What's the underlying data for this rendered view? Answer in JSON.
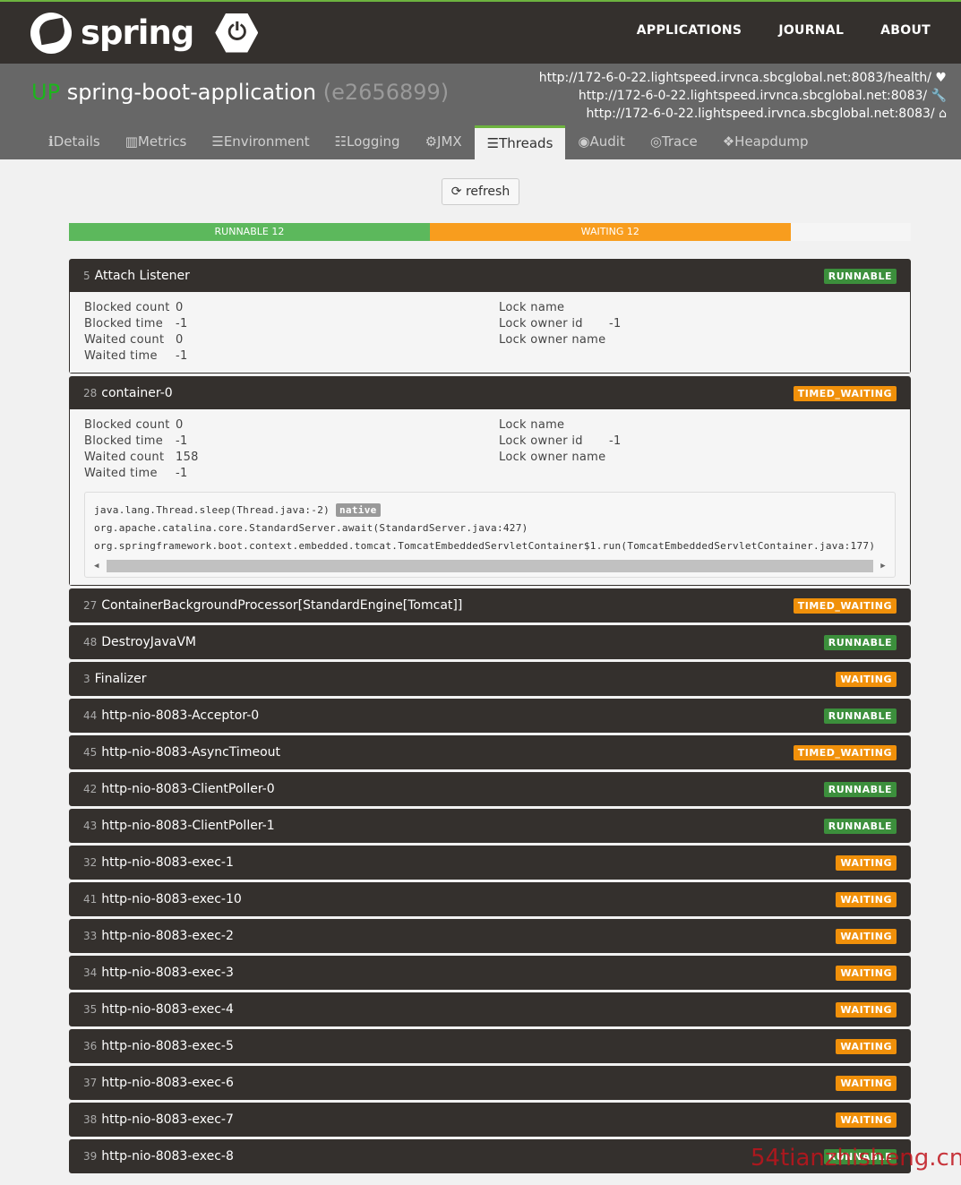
{
  "header": {
    "brand": "spring",
    "nav": [
      "APPLICATIONS",
      "JOURNAL",
      "ABOUT"
    ]
  },
  "app": {
    "status": "UP",
    "name": "spring-boot-application",
    "version": "(e2656899)",
    "urls": [
      {
        "text": "http://172-6-0-22.lightspeed.irvnca.sbcglobal.net:8083/health/",
        "icon": "heartbeat-icon",
        "glyph": "♥"
      },
      {
        "text": "http://172-6-0-22.lightspeed.irvnca.sbcglobal.net:8083/",
        "icon": "wrench-icon",
        "glyph": "🔧"
      },
      {
        "text": "http://172-6-0-22.lightspeed.irvnca.sbcglobal.net:8083/",
        "icon": "home-icon",
        "glyph": "⌂"
      }
    ]
  },
  "tabs": [
    {
      "label": "Details",
      "icon": "ℹ"
    },
    {
      "label": "Metrics",
      "icon": "▥"
    },
    {
      "label": "Environment",
      "icon": "☰"
    },
    {
      "label": "Logging",
      "icon": "☷"
    },
    {
      "label": "JMX",
      "icon": "⚙"
    },
    {
      "label": "Threads",
      "icon": "☰",
      "active": true
    },
    {
      "label": "Audit",
      "icon": "◉"
    },
    {
      "label": "Trace",
      "icon": "◎"
    },
    {
      "label": "Heapdump",
      "icon": "❖"
    }
  ],
  "refresh_label": "refresh",
  "summary": [
    {
      "label": "RUNNABLE 12",
      "fraction": 0.4286,
      "color": "#5cb85c"
    },
    {
      "label": "WAITING 12",
      "fraction": 0.4286,
      "color": "#f89d1e"
    }
  ],
  "colors": {
    "RUNNABLE": "#3c8f3c",
    "WAITING": "#f0900a",
    "TIMED_WAITING": "#f0900a"
  },
  "details_labels": {
    "blocked_count": "Blocked count",
    "blocked_time": "Blocked time",
    "waited_count": "Waited count",
    "waited_time": "Waited time",
    "lock_name": "Lock name",
    "lock_owner_id": "Lock owner id",
    "lock_owner_name": "Lock owner name"
  },
  "threads": [
    {
      "id": "5",
      "name": "Attach Listener",
      "state": "RUNNABLE",
      "expanded": true,
      "blocked_count": "0",
      "blocked_time": "-1",
      "waited_count": "0",
      "waited_time": "-1",
      "lock_name": "",
      "lock_owner_id": "-1",
      "lock_owner_name": ""
    },
    {
      "id": "28",
      "name": "container-0",
      "state": "TIMED_WAITING",
      "expanded": true,
      "blocked_count": "0",
      "blocked_time": "-1",
      "waited_count": "158",
      "waited_time": "-1",
      "lock_name": "",
      "lock_owner_id": "-1",
      "lock_owner_name": "",
      "stack": [
        {
          "text": "java.lang.Thread.sleep(Thread.java:-2)",
          "native": "native"
        },
        {
          "text": "org.apache.catalina.core.StandardServer.await(StandardServer.java:427)"
        },
        {
          "text": "org.springframework.boot.context.embedded.tomcat.TomcatEmbeddedServletContainer$1.run(TomcatEmbeddedServletContainer.java:177)"
        }
      ]
    },
    {
      "id": "27",
      "name": "ContainerBackgroundProcessor[StandardEngine[Tomcat]]",
      "state": "TIMED_WAITING"
    },
    {
      "id": "48",
      "name": "DestroyJavaVM",
      "state": "RUNNABLE"
    },
    {
      "id": "3",
      "name": "Finalizer",
      "state": "WAITING"
    },
    {
      "id": "44",
      "name": "http-nio-8083-Acceptor-0",
      "state": "RUNNABLE"
    },
    {
      "id": "45",
      "name": "http-nio-8083-AsyncTimeout",
      "state": "TIMED_WAITING"
    },
    {
      "id": "42",
      "name": "http-nio-8083-ClientPoller-0",
      "state": "RUNNABLE"
    },
    {
      "id": "43",
      "name": "http-nio-8083-ClientPoller-1",
      "state": "RUNNABLE"
    },
    {
      "id": "32",
      "name": "http-nio-8083-exec-1",
      "state": "WAITING"
    },
    {
      "id": "41",
      "name": "http-nio-8083-exec-10",
      "state": "WAITING"
    },
    {
      "id": "33",
      "name": "http-nio-8083-exec-2",
      "state": "WAITING"
    },
    {
      "id": "34",
      "name": "http-nio-8083-exec-3",
      "state": "WAITING"
    },
    {
      "id": "35",
      "name": "http-nio-8083-exec-4",
      "state": "WAITING"
    },
    {
      "id": "36",
      "name": "http-nio-8083-exec-5",
      "state": "WAITING"
    },
    {
      "id": "37",
      "name": "http-nio-8083-exec-6",
      "state": "WAITING"
    },
    {
      "id": "38",
      "name": "http-nio-8083-exec-7",
      "state": "WAITING"
    },
    {
      "id": "39",
      "name": "http-nio-8083-exec-8",
      "state": "RUNNABLE"
    }
  ],
  "watermark": "54tianzhisheng.cn"
}
